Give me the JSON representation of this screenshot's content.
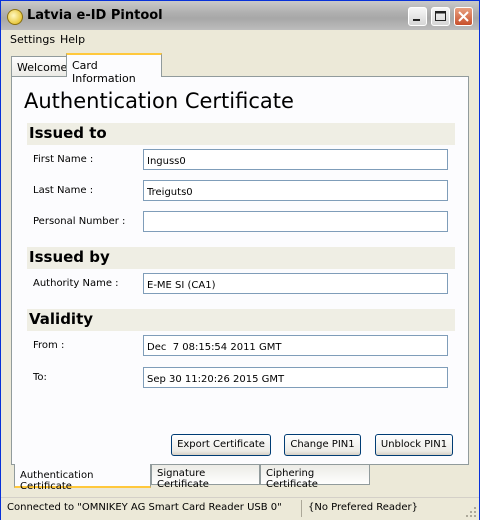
{
  "window": {
    "title": "Latvia e-ID Pintool"
  },
  "menu": {
    "items": [
      "Settings",
      "Help"
    ]
  },
  "top_tabs": [
    {
      "label": "Welcome",
      "active": false
    },
    {
      "label": "Card Information",
      "active": true
    }
  ],
  "certificate": {
    "heading": "Authentication Certificate",
    "issued_to": {
      "title": "Issued to",
      "first_name_label": "First Name :",
      "first_name_value": "Inguss0",
      "last_name_label": "Last Name :",
      "last_name_value": "Treiguts0",
      "personal_number_label": "Personal Number :",
      "personal_number_value": ""
    },
    "issued_by": {
      "title": "Issued by",
      "authority_label": "Authority Name :",
      "authority_value": "E-ME SI (CA1)"
    },
    "validity": {
      "title": "Validity",
      "from_label": "From :",
      "from_value": "Dec  7 08:15:54 2011 GMT",
      "to_label": "To:",
      "to_value": "Sep 30 11:20:26 2015 GMT"
    }
  },
  "buttons": {
    "export": "Export Certificate",
    "change_pin": "Change PIN1",
    "unblock_pin": "Unblock PIN1"
  },
  "bottom_tabs": [
    {
      "label": "Authentication Certificate",
      "active": true
    },
    {
      "label": "Signature Certificate",
      "active": false
    },
    {
      "label": "Ciphering Certificate",
      "active": false
    }
  ],
  "status": {
    "connection": "Connected to \"OMNIKEY AG Smart Card Reader USB 0\"",
    "reader": "{No Prefered Reader}"
  },
  "colors": {
    "tab_highlight": "#ffc83c",
    "section_background": "#efeee4",
    "window_background": "#ece9d8",
    "close_button": "#c8502c"
  }
}
